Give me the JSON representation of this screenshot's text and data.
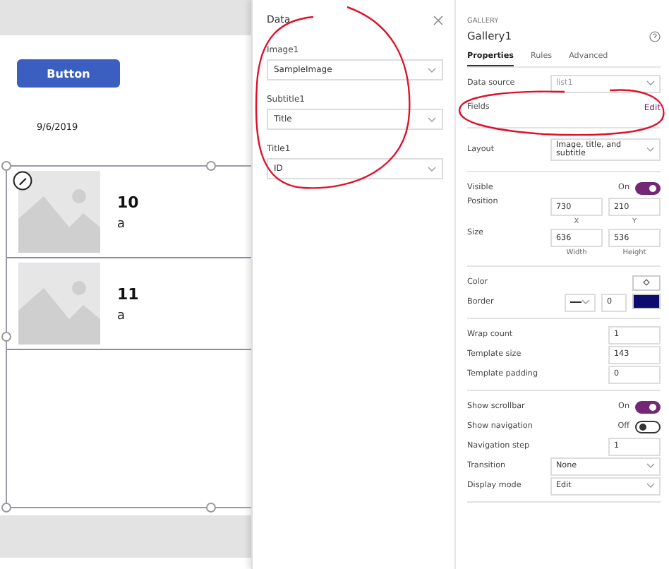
{
  "canvas": {
    "button": "Button",
    "date": "9/6/2019",
    "gallery_items": [
      {
        "title": "10",
        "subtitle": "a",
        "selected": true
      },
      {
        "title": "11",
        "subtitle": "a",
        "selected": false
      }
    ]
  },
  "data_panel": {
    "title": "Data",
    "fields": [
      {
        "label": "Image1",
        "value": "SampleImage"
      },
      {
        "label": "Subtitle1",
        "value": "Title"
      },
      {
        "label": "Title1",
        "value": "ID"
      }
    ]
  },
  "properties": {
    "type": "GALLERY",
    "name": "Gallery1",
    "tabs": [
      {
        "label": "Properties",
        "selected": true
      },
      {
        "label": "Rules",
        "selected": false
      },
      {
        "label": "Advanced",
        "selected": false
      }
    ],
    "sections": [
      [
        {
          "kind": "select",
          "label": "Data source",
          "value": "list1",
          "disabled": true
        },
        {
          "kind": "link",
          "label": "Fields",
          "value": "Edit"
        }
      ],
      [
        {
          "kind": "select",
          "label": "Layout",
          "value": "Image, title, and subtitle",
          "disabled": false
        }
      ],
      [
        {
          "kind": "toggle",
          "label": "Visible",
          "value": "On",
          "on": true
        },
        {
          "kind": "pair",
          "label": "Position",
          "values": [
            {
              "value": "730",
              "caption": "X"
            },
            {
              "value": "210",
              "caption": "Y"
            }
          ]
        },
        {
          "kind": "pair",
          "label": "Size",
          "values": [
            {
              "value": "636",
              "caption": "Width"
            },
            {
              "value": "536",
              "caption": "Height"
            }
          ]
        }
      ],
      [
        {
          "kind": "color",
          "label": "Color"
        },
        {
          "kind": "border",
          "label": "Border",
          "value": "0",
          "color": "#0c0c6e"
        }
      ],
      [
        {
          "kind": "number",
          "label": "Wrap count",
          "value": "1"
        },
        {
          "kind": "number",
          "label": "Template size",
          "value": "143"
        },
        {
          "kind": "number",
          "label": "Template padding",
          "value": "0"
        }
      ],
      [
        {
          "kind": "toggle",
          "label": "Show scrollbar",
          "value": "On",
          "on": true
        },
        {
          "kind": "toggle",
          "label": "Show navigation",
          "value": "Off",
          "on": false
        },
        {
          "kind": "number",
          "label": "Navigation step",
          "value": "1"
        },
        {
          "kind": "select",
          "label": "Transition",
          "value": "None",
          "disabled": false
        },
        {
          "kind": "select",
          "label": "Display mode",
          "value": "Edit",
          "disabled": false
        }
      ]
    ]
  }
}
